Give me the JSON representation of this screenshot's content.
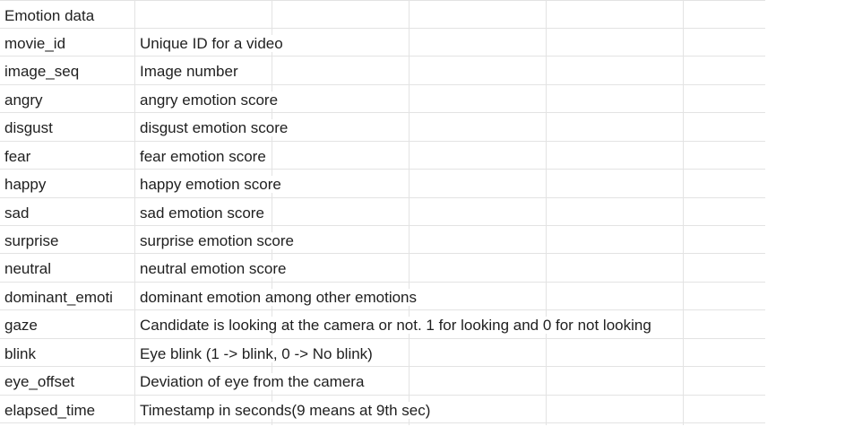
{
  "sheet": {
    "rows": [
      {
        "name": "Emotion data",
        "desc": ""
      },
      {
        "name": "movie_id",
        "desc": "Unique ID for a video"
      },
      {
        "name": "image_seq",
        "desc": "Image number"
      },
      {
        "name": "angry",
        "desc": "angry emotion score"
      },
      {
        "name": "disgust",
        "desc": "disgust emotion score"
      },
      {
        "name": "fear",
        "desc": "fear emotion score"
      },
      {
        "name": "happy",
        "desc": "happy emotion score"
      },
      {
        "name": "sad",
        "desc": "sad emotion score"
      },
      {
        "name": "surprise",
        "desc": "surprise emotion score"
      },
      {
        "name": "neutral",
        "desc": "neutral emotion score"
      },
      {
        "name": "dominant_emoti",
        "desc": "dominant emotion among other emotions"
      },
      {
        "name": "gaze",
        "desc": "Candidate is looking at the camera or not. 1 for looking and 0 for not looking"
      },
      {
        "name": "blink",
        "desc": "Eye blink (1 -> blink, 0 -> No blink)"
      },
      {
        "name": "eye_offset",
        "desc": "Deviation of eye from the camera"
      },
      {
        "name": "elapsed_time",
        "desc": "Timestamp in seconds(9 means at 9th sec)"
      }
    ]
  }
}
